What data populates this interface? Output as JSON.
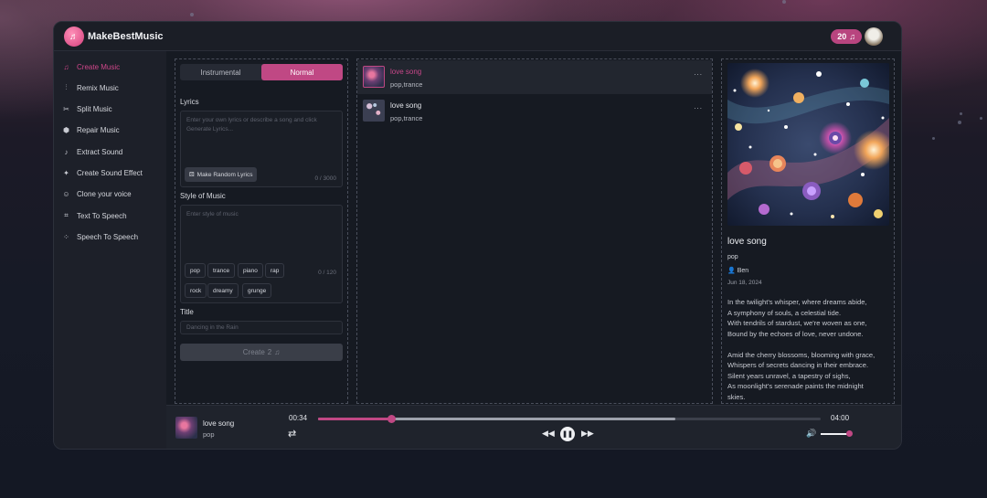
{
  "app": {
    "brand": "MakeBestMusic",
    "credits": "20",
    "credits_icon": "music-note-icon"
  },
  "sidebar": {
    "items": [
      {
        "label": "Create Music",
        "icon": "music-notes-icon",
        "active": true
      },
      {
        "label": "Remix Music",
        "icon": "sliders-icon"
      },
      {
        "label": "Split Music",
        "icon": "split-icon"
      },
      {
        "label": "Repair Music",
        "icon": "cube-icon"
      },
      {
        "label": "Extract Sound",
        "icon": "waveform-icon"
      },
      {
        "label": "Create Sound Effect",
        "icon": "sparkle-icon"
      },
      {
        "label": "Clone your voice",
        "icon": "voice-icon"
      },
      {
        "label": "Text To Speech",
        "icon": "scan-icon"
      },
      {
        "label": "Speech To Speech",
        "icon": "speech-wave-icon"
      }
    ]
  },
  "form": {
    "mode_tabs": [
      "Instrumental",
      "Normal"
    ],
    "selected_mode": "Normal",
    "lyrics_label": "Lyrics",
    "lyrics_placeholder": "Enter your own lyrics or describe a song and click Generate Lyrics...",
    "random_lyrics_button": "Make Random Lyrics",
    "lyrics_count": "0 / 3000",
    "style_label": "Style of Music",
    "style_placeholder": "Enter style of music",
    "style_tags": [
      "pop",
      "trance",
      "piano",
      "rap",
      "rock",
      "dreamy",
      "grunge"
    ],
    "style_count": "0 / 120",
    "title_label": "Title",
    "title_placeholder": "Dancing in the Rain",
    "create_button": "Create",
    "create_cost": "2"
  },
  "songs": [
    {
      "title": "love song",
      "tags": "pop,trance",
      "playing": true,
      "menu": "..."
    },
    {
      "title": "love song",
      "tags": "pop,trance",
      "playing": false,
      "menu": "..."
    }
  ],
  "detail": {
    "title": "love song",
    "genre": "pop",
    "author": "Ben",
    "date": "Jun 18, 2024",
    "lyrics": "In the twilight's whisper, where dreams abide,\nA symphony of souls, a celestial tide.\nWith tendrils of stardust, we're woven as one,\nBound by the echoes of love, never undone.\n\nAmid the cherry blossoms, blooming with grace,\nWhispers of secrets dancing in their embrace.\nSilent years unravel, a tapestry of sighs,\nAs moonlight's serenade paints the midnight\nskies."
  },
  "player": {
    "title": "love song",
    "genre": "pop",
    "current_time": "00:34",
    "total_time": "04:00",
    "progress": 0.146,
    "buffered": 0.71,
    "volume": 0.9
  }
}
